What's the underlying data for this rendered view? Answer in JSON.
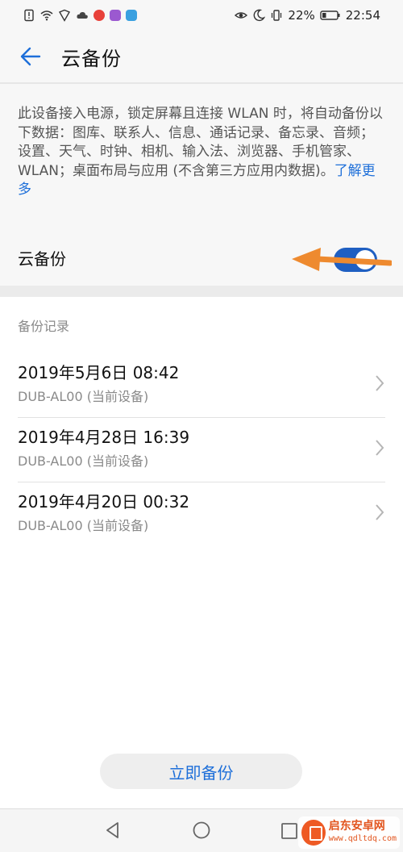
{
  "status_bar": {
    "battery_percent": "22%",
    "time": "22:54"
  },
  "app_bar": {
    "title": "云备份"
  },
  "description": {
    "text": "此设备接入电源，锁定屏幕且连接 WLAN 时，将自动备份以下数据：图库、联系人、信息、通话记录、备忘录、音频；设置、天气、时钟、相机、输入法、浏览器、手机管家、WLAN；桌面布局与应用 (不含第三方应用内数据)。",
    "link": "了解更多"
  },
  "toggle": {
    "label": "云备份",
    "on": true,
    "color": "#1f5fc2"
  },
  "annotation": {
    "arrow_color": "#ee8a2f"
  },
  "records": {
    "header": "备份记录",
    "items": [
      {
        "date": "2019年5月6日 08:42",
        "device": "DUB-AL00 (当前设备)"
      },
      {
        "date": "2019年4月28日 16:39",
        "device": "DUB-AL00 (当前设备)"
      },
      {
        "date": "2019年4月20日 00:32",
        "device": "DUB-AL00 (当前设备)"
      }
    ]
  },
  "backup_button": {
    "label": "立即备份"
  },
  "watermark": {
    "name": "启东安卓网",
    "url": "www.qdltdq.com"
  }
}
